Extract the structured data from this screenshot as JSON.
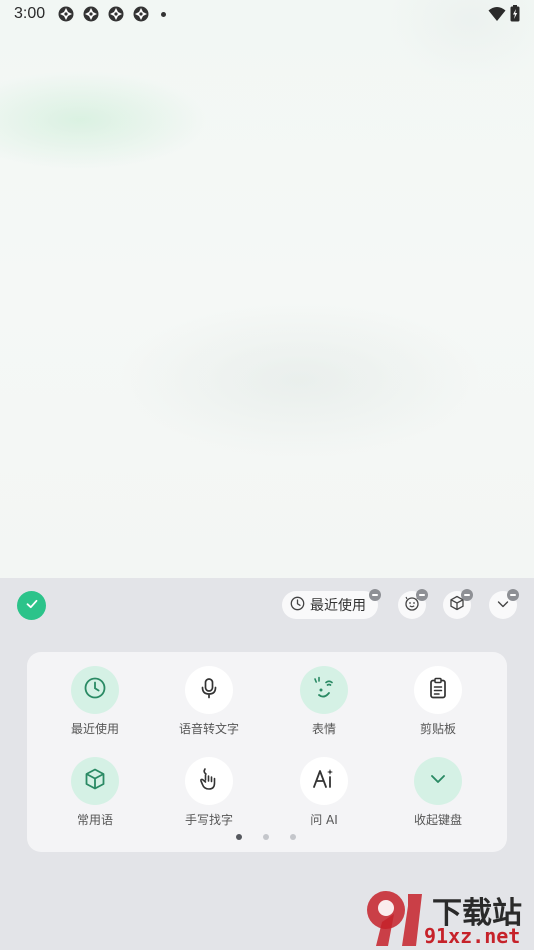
{
  "status_bar": {
    "time": "3:00",
    "notification_icons": [
      "pinwheel-icon",
      "pinwheel-icon",
      "pinwheel-icon",
      "pinwheel-icon"
    ],
    "right_icons": [
      "wifi-icon",
      "battery-charging-icon"
    ]
  },
  "toolbar": {
    "confirm_icon": "check-icon",
    "recent_chip_label": "最近使用",
    "chip_icons": [
      "emoji-icon",
      "cube-icon",
      "chevron-down-icon"
    ]
  },
  "panel": {
    "items": [
      {
        "label": "最近使用",
        "icon": "clock-icon",
        "style": "green"
      },
      {
        "label": "语音转文字",
        "icon": "mic-icon",
        "style": "white"
      },
      {
        "label": "表情",
        "icon": "emoji-icon",
        "style": "green"
      },
      {
        "label": "剪贴板",
        "icon": "clipboard-icon",
        "style": "white"
      },
      {
        "label": "常用语",
        "icon": "cube-icon",
        "style": "green"
      },
      {
        "label": "手写找字",
        "icon": "handwriting-icon",
        "style": "white"
      },
      {
        "label": "问 AI",
        "icon": "ai-icon",
        "style": "white"
      },
      {
        "label": "收起键盘",
        "icon": "chevron-down-icon",
        "style": "green"
      }
    ],
    "page_count": 3,
    "active_page": 1
  },
  "watermark": {
    "logo_text": "91",
    "title": "下载站",
    "url": "91xz.net"
  },
  "colors": {
    "accent": "#2cc38a",
    "accent_light": "#d5f1e5",
    "keyboard_bg": "#e3e4e8",
    "panel_bg": "#f4f4f6",
    "watermark_red": "#c6222a"
  }
}
